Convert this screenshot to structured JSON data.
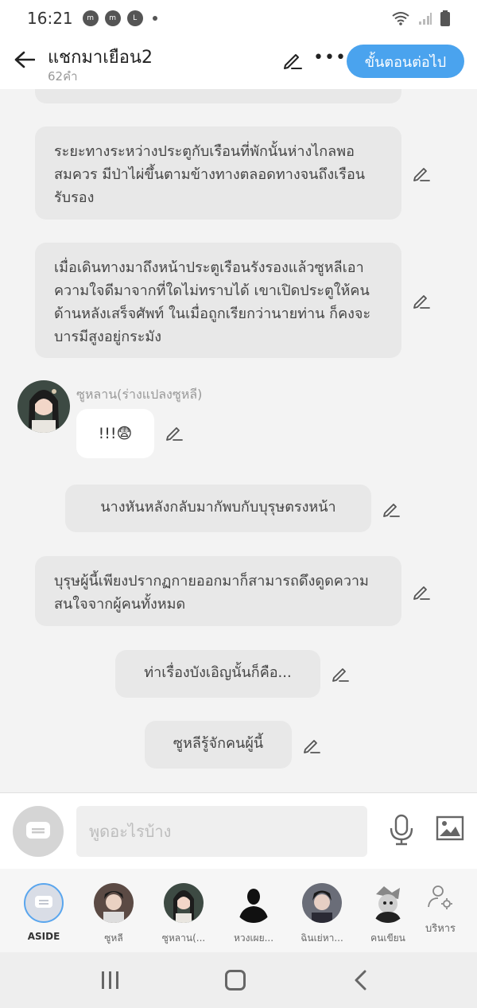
{
  "status_bar": {
    "time": "16:21"
  },
  "header": {
    "title": "แชกมาเยือน2",
    "subtitle": "62คำ",
    "next_label": "ขั้นตอนต่อไป"
  },
  "messages": [
    {
      "type": "narration",
      "text": "ระยะทางระหว่างประตูกับเรือนที่พักนั้นห่างไกลพอสมควร มีป่าไผ่ขึ้นตามข้างทางตลอดทางจนถึงเรือนรับรอง"
    },
    {
      "type": "narration",
      "text": "เมื่อเดินทางมาถึงหน้าประตูเรือนรังรองแล้วซูหลีเอาความใจดีมาจากที่ใดไม่ทราบได้ เขาเปิดประตูให้คนด้านหลังเสร็จศัพท์ ในเมื่อถูกเรียกว่านายท่าน ก็คงจะบารมีสูงอยู่กระมัง"
    },
    {
      "type": "character",
      "speaker": "ซูหลาน(ร่างแปลงซูหลี)",
      "text": "!!!😨"
    },
    {
      "type": "narration",
      "text": "นางหันหลังกลับมากัพบกับบุรุษตรงหน้า"
    },
    {
      "type": "narration",
      "text": "บุรุษผู้นี้เพียงปรากฏกายออกมาก็สามารถดึงดูดความสนใจจากผู้คนทั้งหมด"
    },
    {
      "type": "narration",
      "text": "ท่าเรื่องบังเอิญนั้นก็คือ..."
    },
    {
      "type": "narration",
      "text": "ซูหลีรู้จักคนผู้นี้"
    }
  ],
  "input": {
    "placeholder": "พูดอะไรบ้าง"
  },
  "characters": [
    {
      "label": "ASIDE"
    },
    {
      "label": "ซูหลี"
    },
    {
      "label": "ซูหลาน(..."
    },
    {
      "label": "หวงเผย..."
    },
    {
      "label": "ฉินเย่หา..."
    },
    {
      "label": "คนเขียน"
    }
  ],
  "manage_label": "บริหาร",
  "colors": {
    "accent": "#4aa3ee",
    "bubble": "#e8e8e8"
  }
}
